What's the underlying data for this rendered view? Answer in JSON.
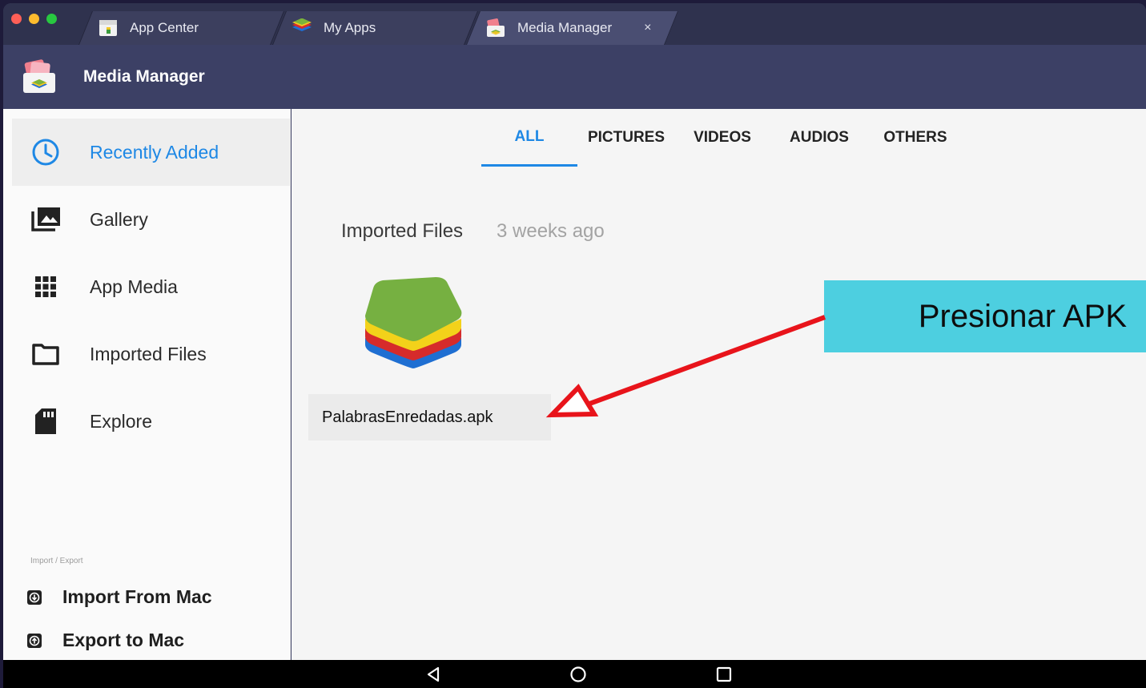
{
  "window": {
    "tabs": [
      {
        "label": "App Center",
        "icon": "app-center-icon"
      },
      {
        "label": "My Apps",
        "icon": "bluestacks-icon"
      },
      {
        "label": "Media Manager",
        "icon": "media-manager-icon",
        "active": true,
        "close": "×"
      }
    ],
    "traffic_colors": [
      "#fe5f57",
      "#febc2e",
      "#28c840"
    ]
  },
  "header": {
    "title": "Media Manager",
    "icon": "media-manager-icon"
  },
  "sidebar": {
    "items": [
      {
        "label": "Recently Added",
        "icon": "clock-icon",
        "active": true
      },
      {
        "label": "Gallery",
        "icon": "photo-library-icon"
      },
      {
        "label": "App Media",
        "icon": "apps-grid-icon"
      },
      {
        "label": "Imported Files",
        "icon": "folder-icon"
      },
      {
        "label": "Explore",
        "icon": "sd-card-icon"
      }
    ],
    "section_label": "Import / Export",
    "import_label": "Import From Mac",
    "export_label": "Export to Mac"
  },
  "main": {
    "tabs": [
      "ALL",
      "PICTURES",
      "VIDEOS",
      "AUDIOS",
      "OTHERS"
    ],
    "active_tab": "ALL",
    "section_title": "Imported Files",
    "section_time": "3 weeks ago",
    "file": {
      "name": "PalabrasEnredadas.apk",
      "icon": "bluestacks-apk-icon"
    }
  },
  "annotation": {
    "text": "Presionar APK",
    "color": "#4dcfe0",
    "arrow_color": "#e8141b"
  },
  "colors": {
    "accent": "#1e88e5",
    "header_bg": "#3c4065"
  }
}
